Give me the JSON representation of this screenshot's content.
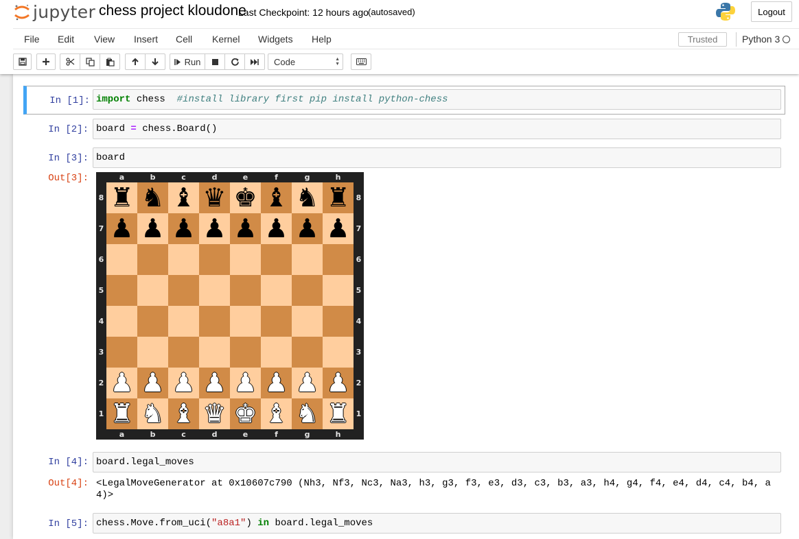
{
  "header": {
    "logo_text": "jupyter",
    "notebook_title": "chess project kloudone",
    "checkpoint": "Last Checkpoint: 12 hours ago",
    "autosave": "(autosaved)",
    "logout_label": "Logout"
  },
  "menubar": {
    "items": [
      "File",
      "Edit",
      "View",
      "Insert",
      "Cell",
      "Kernel",
      "Widgets",
      "Help"
    ],
    "trusted": "Trusted",
    "kernel_name": "Python 3"
  },
  "toolbar": {
    "run_label": "Run",
    "cell_type": "Code",
    "icons": [
      "save-icon",
      "plus-icon",
      "cut-icon",
      "copy-icon",
      "paste-icon",
      "arrow-up-icon",
      "arrow-down-icon",
      "run-icon",
      "stop-icon",
      "restart-icon",
      "fast-forward-icon",
      "keyboard-icon"
    ]
  },
  "cells": [
    {
      "prompt": "In [1]:",
      "tokens": [
        {
          "t": "import",
          "c": "kw"
        },
        {
          "t": " chess  ",
          "c": ""
        },
        {
          "t": "#install library first pip install python-chess",
          "c": "cm"
        }
      ]
    },
    {
      "prompt": "In [2]:",
      "tokens": [
        {
          "t": "board ",
          "c": ""
        },
        {
          "t": "=",
          "c": "op"
        },
        {
          "t": " chess.Board()",
          "c": ""
        }
      ]
    },
    {
      "prompt": "In [3]:",
      "tokens": [
        {
          "t": "board",
          "c": ""
        }
      ]
    },
    {
      "prompt": "In [4]:",
      "tokens": [
        {
          "t": "board.legal_moves",
          "c": ""
        }
      ]
    },
    {
      "prompt": "In [5]:",
      "tokens": [
        {
          "t": "chess.Move.from_uci(",
          "c": ""
        },
        {
          "t": "\"a8a1\"",
          "c": "st"
        },
        {
          "t": ") ",
          "c": ""
        },
        {
          "t": "in",
          "c": "kw"
        },
        {
          "t": " board.legal_moves",
          "c": ""
        }
      ]
    }
  ],
  "outputs": {
    "out3_prompt": "Out[3]:",
    "out4_prompt": "Out[4]:",
    "out4_text": "<LegalMoveGenerator at 0x10607c790 (Nh3, Nf3, Nc3, Na3, h3, g3, f3, e3, d3, c3, b3, a3, h4, g4, f4, e4, d4, c4, b4, a4)>"
  },
  "chessboard": {
    "files": [
      "a",
      "b",
      "c",
      "d",
      "e",
      "f",
      "g",
      "h"
    ],
    "ranks": [
      "8",
      "7",
      "6",
      "5",
      "4",
      "3",
      "2",
      "1"
    ],
    "position": [
      "rnbqkbnr",
      "pppppppp",
      "........",
      "........",
      "........",
      "........",
      "PPPPPPPP",
      "RNBQKBNR"
    ],
    "light_color": "#ffce9e",
    "dark_color": "#d18b47",
    "border_color": "#212121"
  },
  "colors": {
    "prompt_in": "#303f9f",
    "prompt_out": "#d84315",
    "selected_cell_accent": "#42a5f5"
  }
}
